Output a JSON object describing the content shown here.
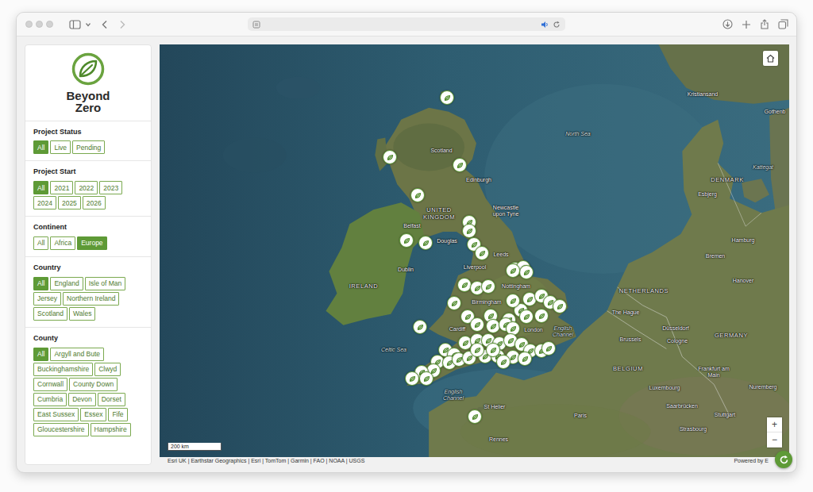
{
  "sidebar": {
    "logo": {
      "line1": "Beyond",
      "line2": "Zero"
    },
    "filters": [
      {
        "title": "Project Status",
        "kind": "inline",
        "options": [
          {
            "label": "All",
            "selected": true
          },
          {
            "label": "Live",
            "selected": false
          },
          {
            "label": "Pending",
            "selected": false
          }
        ]
      },
      {
        "title": "Project Start",
        "kind": "inline",
        "options": [
          {
            "label": "All",
            "selected": true
          },
          {
            "label": "2021",
            "selected": false
          },
          {
            "label": "2022",
            "selected": false
          },
          {
            "label": "2023",
            "selected": false
          },
          {
            "label": "2024",
            "selected": false
          },
          {
            "label": "2025",
            "selected": false
          },
          {
            "label": "2026",
            "selected": false
          }
        ]
      },
      {
        "title": "Continent",
        "kind": "inline",
        "options": [
          {
            "label": "All",
            "selected": false
          },
          {
            "label": "Africa",
            "selected": false
          },
          {
            "label": "Europe",
            "selected": true
          }
        ]
      },
      {
        "title": "Country",
        "kind": "inline",
        "options": [
          {
            "label": "All",
            "selected": true
          },
          {
            "label": "England",
            "selected": false
          },
          {
            "label": "Isle of Man",
            "selected": false
          },
          {
            "label": "Jersey",
            "selected": false
          },
          {
            "label": "Northern Ireland",
            "selected": false
          },
          {
            "label": "Scotland",
            "selected": false
          },
          {
            "label": "Wales",
            "selected": false
          }
        ]
      },
      {
        "title": "County",
        "kind": "scroll",
        "options": [
          {
            "label": "All",
            "selected": true
          },
          {
            "label": "Argyll and Bute",
            "selected": false
          },
          {
            "label": "Buckinghamshire",
            "selected": false
          },
          {
            "label": "Clwyd",
            "selected": false
          },
          {
            "label": "Cornwall",
            "selected": false
          },
          {
            "label": "County Down",
            "selected": false
          },
          {
            "label": "Cumbria",
            "selected": false
          },
          {
            "label": "Devon",
            "selected": false
          },
          {
            "label": "Dorset",
            "selected": false
          },
          {
            "label": "East Sussex",
            "selected": false
          },
          {
            "label": "Essex",
            "selected": false
          },
          {
            "label": "Fife",
            "selected": false
          },
          {
            "label": "Gloucestershire",
            "selected": false
          },
          {
            "label": "Hampshire",
            "selected": false
          }
        ]
      }
    ]
  },
  "map": {
    "labels": [
      {
        "text": "Scotland",
        "kind": "city"
      },
      {
        "text": "Edinburgh",
        "kind": "city"
      },
      {
        "text": "Newcastle upon Tyne",
        "kind": "city"
      },
      {
        "text": "UNITED KINGDOM",
        "kind": "country"
      },
      {
        "text": "Belfast",
        "kind": "city"
      },
      {
        "text": "Douglas",
        "kind": "city"
      },
      {
        "text": "Dublin",
        "kind": "city"
      },
      {
        "text": "IRELAND",
        "kind": "country"
      },
      {
        "text": "Liverpool",
        "kind": "city"
      },
      {
        "text": "Leeds",
        "kind": "city"
      },
      {
        "text": "Nottingham",
        "kind": "city"
      },
      {
        "text": "Birmingham",
        "kind": "city"
      },
      {
        "text": "Cardiff",
        "kind": "city"
      },
      {
        "text": "London",
        "kind": "city"
      },
      {
        "text": "English Channel",
        "kind": "sea"
      },
      {
        "text": "Celtic Sea",
        "kind": "sea"
      },
      {
        "text": "English Channel",
        "kind": "sea"
      },
      {
        "text": "St Helier",
        "kind": "city"
      },
      {
        "text": "North Sea",
        "kind": "sea"
      },
      {
        "text": "DENMARK",
        "kind": "country"
      },
      {
        "text": "Esbjerg",
        "kind": "city"
      },
      {
        "text": "Kattegat",
        "kind": "sea"
      },
      {
        "text": "Kristiansand",
        "kind": "city"
      },
      {
        "text": "Gothenb",
        "kind": "city"
      },
      {
        "text": "Hamburg",
        "kind": "city"
      },
      {
        "text": "Bremen",
        "kind": "city"
      },
      {
        "text": "NETHERLANDS",
        "kind": "country"
      },
      {
        "text": "The Hague",
        "kind": "city"
      },
      {
        "text": "Hanover",
        "kind": "city"
      },
      {
        "text": "Düsseldorf",
        "kind": "city"
      },
      {
        "text": "Brussels",
        "kind": "city"
      },
      {
        "text": "Cologne",
        "kind": "city"
      },
      {
        "text": "BELGIUM",
        "kind": "country"
      },
      {
        "text": "GERMANY",
        "kind": "country"
      },
      {
        "text": "Frankfurt am Main",
        "kind": "city"
      },
      {
        "text": "Luxembourg",
        "kind": "city"
      },
      {
        "text": "Saarbrücken",
        "kind": "city"
      },
      {
        "text": "Nuremberg",
        "kind": "city"
      },
      {
        "text": "Stuttgart",
        "kind": "city"
      },
      {
        "text": "Strasbourg",
        "kind": "city"
      },
      {
        "text": "Paris",
        "kind": "city"
      },
      {
        "text": "Rennes",
        "kind": "city"
      }
    ],
    "scale": "200 km",
    "zoom": {
      "in": "+",
      "out": "−"
    }
  },
  "footer": {
    "attribution": "Esri UK | Earthstar Geographics | Esri | TomTom | Garmin | FAO | NOAA | USGS",
    "powered_by": "Powered by E"
  }
}
